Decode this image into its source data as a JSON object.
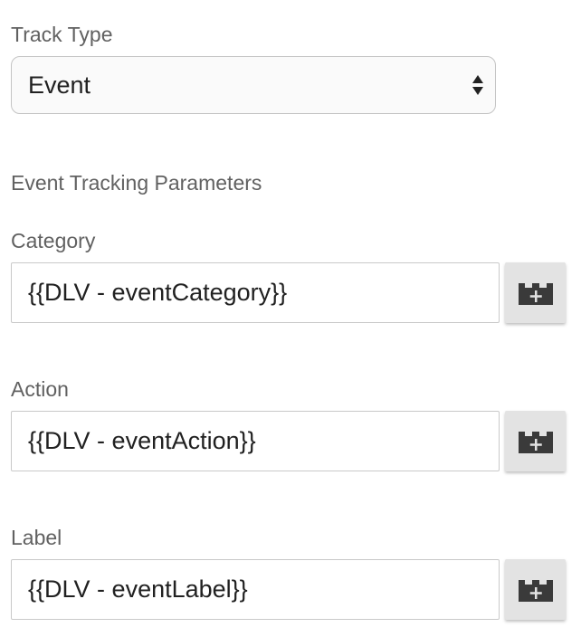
{
  "track_type": {
    "label": "Track Type",
    "selected": "Event"
  },
  "section_heading": "Event Tracking Parameters",
  "fields": [
    {
      "label": "Category",
      "value": "{{DLV - eventCategory}}",
      "icon": "variable-picker-icon"
    },
    {
      "label": "Action",
      "value": "{{DLV - eventAction}}",
      "icon": "variable-picker-icon"
    },
    {
      "label": "Label",
      "value": "{{DLV - eventLabel}}",
      "icon": "variable-picker-icon"
    }
  ]
}
